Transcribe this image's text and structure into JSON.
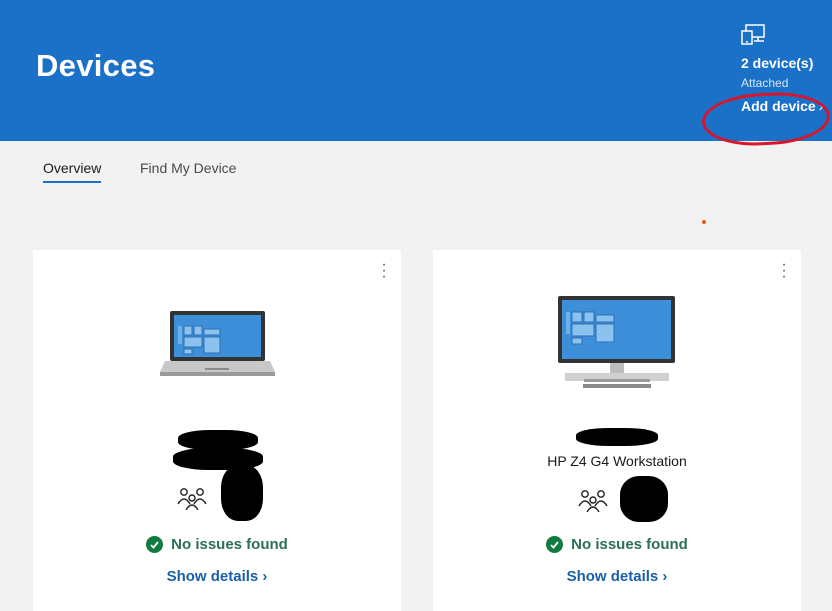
{
  "header": {
    "title": "Devices",
    "device_count": "2 device(s)",
    "attached_label": "Attached",
    "add_device_label": "Add device",
    "add_device_chevron": "›"
  },
  "tabs": [
    {
      "label": "Overview",
      "active": true
    },
    {
      "label": "Find My Device",
      "active": false
    }
  ],
  "cards": [
    {
      "device_type": "laptop-icon",
      "name": "",
      "status": "No issues found",
      "details_label": "Show details",
      "details_chevron": "›"
    },
    {
      "device_type": "desktop-icon",
      "name": "HP Z4 G4 Workstation",
      "status": "No issues found",
      "details_label": "Show details",
      "details_chevron": "›"
    }
  ],
  "colors": {
    "header_bg": "#1b70c8",
    "status_green": "#107c41",
    "link_blue": "#1b5fa7",
    "highlight_red": "#d8152b"
  }
}
